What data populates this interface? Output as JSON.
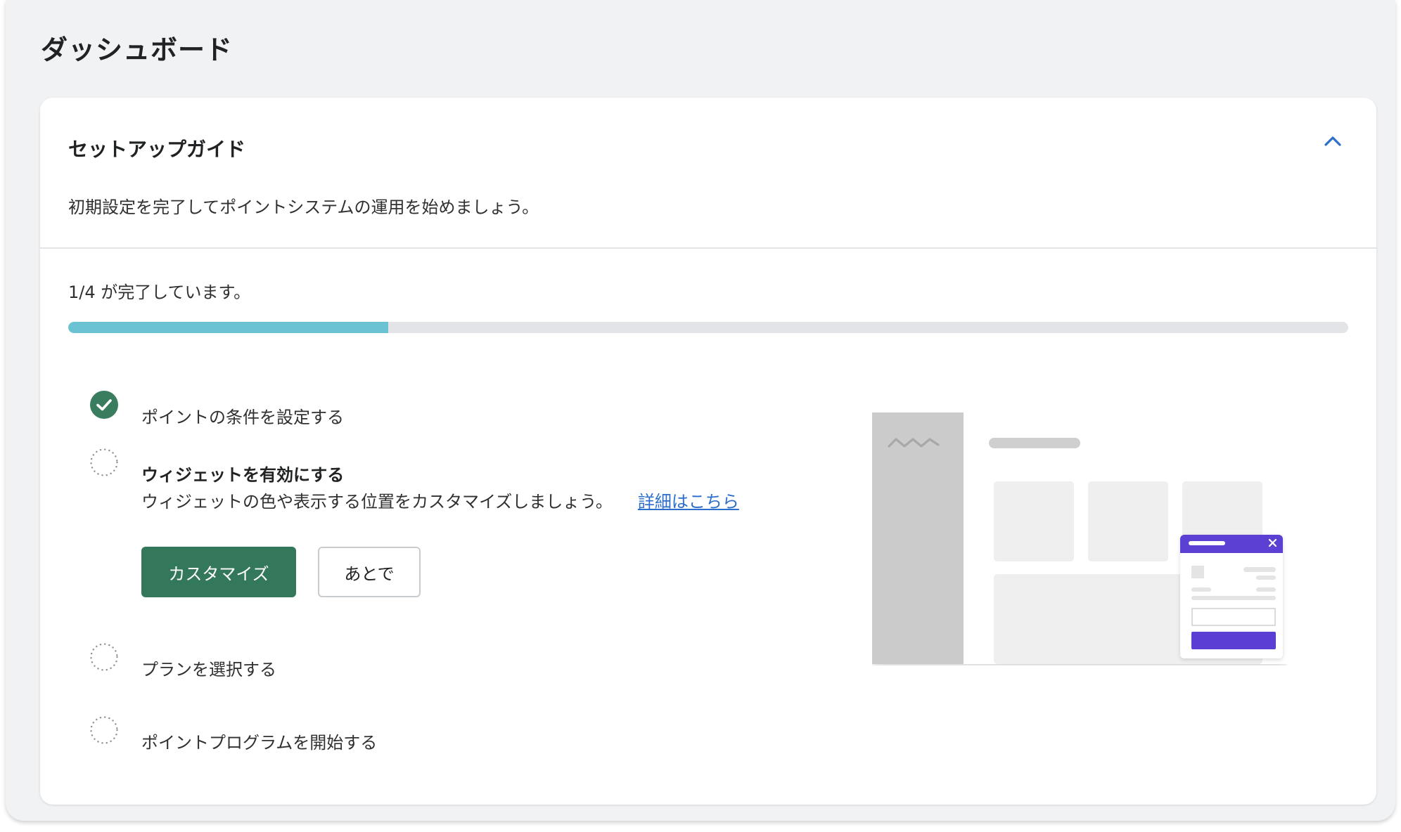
{
  "page": {
    "title": "ダッシュボード"
  },
  "setup_guide": {
    "title": "セットアップガイド",
    "description": "初期設定を完了してポイントシステムの運用を始めましょう。",
    "progress_text": "1/4 が完了しています。",
    "progress_fraction": 0.25,
    "colors": {
      "progress_fill": "#6ac2d2",
      "completed": "#3a7d5e",
      "primary_button": "#34785c",
      "link": "#2c6ecb",
      "widget_accent": "#5b3fd4"
    },
    "steps": [
      {
        "label": "ポイントの条件を設定する",
        "status": "completed",
        "icon": "check-circle-icon"
      },
      {
        "label": "ウィジェットを有効にする",
        "status": "active",
        "icon": "dotted-circle-icon",
        "description": "ウィジェットの色や表示する位置をカスタマイズしましょう。",
        "link_label": "詳細はこちら",
        "primary_action": "カスタマイズ",
        "secondary_action": "あとで"
      },
      {
        "label": "プランを選択する",
        "status": "incomplete",
        "icon": "dotted-circle-icon"
      },
      {
        "label": "ポイントプログラムを開始する",
        "status": "incomplete",
        "icon": "dotted-circle-icon"
      }
    ],
    "collapse_icon": "chevron-up-icon",
    "illustration": "widget-preview-illustration"
  }
}
